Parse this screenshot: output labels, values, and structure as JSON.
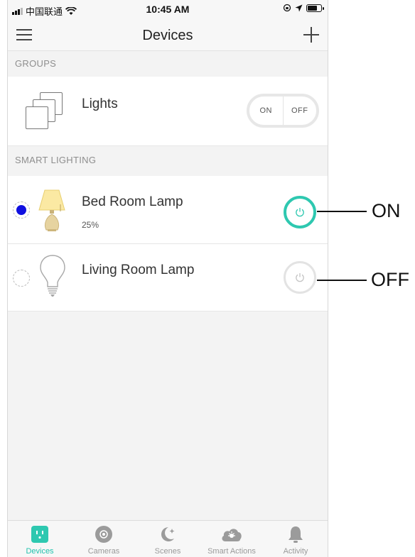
{
  "status_bar": {
    "carrier": "中国联通",
    "time": "10:45 AM"
  },
  "header": {
    "title": "Devices"
  },
  "sections": {
    "groups_label": "GROUPS",
    "smart_lighting_label": "SMART LIGHTING"
  },
  "groups": [
    {
      "name": "Lights",
      "on_label": "ON",
      "off_label": "OFF"
    }
  ],
  "devices": [
    {
      "name": "Bed Room Lamp",
      "brightness": "25%",
      "color_dot": "#1010e0",
      "state": "on"
    },
    {
      "name": "Living Room Lamp",
      "brightness": "",
      "color_dot": "",
      "state": "off"
    }
  ],
  "callouts": {
    "on": "ON",
    "off": "OFF"
  },
  "accent_color": "#2ec8b0",
  "tabs": [
    {
      "label": "Devices",
      "icon": "plug-icon",
      "active": true
    },
    {
      "label": "Cameras",
      "icon": "camera-icon",
      "active": false
    },
    {
      "label": "Scenes",
      "icon": "moon-icon",
      "active": false
    },
    {
      "label": "Smart Actions",
      "icon": "cloud-sun-icon",
      "active": false
    },
    {
      "label": "Activity",
      "icon": "bell-icon",
      "active": false
    }
  ]
}
